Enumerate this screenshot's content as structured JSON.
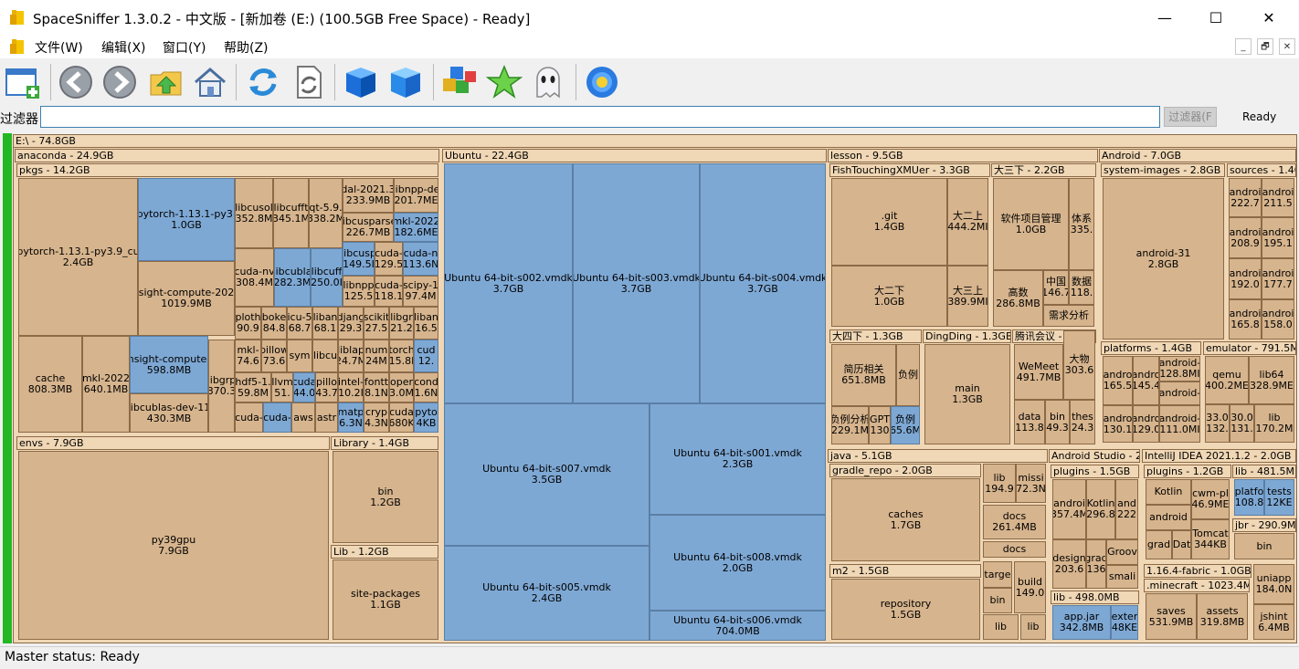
{
  "window": {
    "title": "SpaceSniffer 1.3.0.2  -  中文版  - [新加卷 (E:) (100.5GB Free Space) - Ready]",
    "minimize": "—",
    "maximize": "☐",
    "close": "✕"
  },
  "menu": {
    "items": [
      "文件(W)",
      "编辑(X)",
      "窗口(Y)",
      "帮助(Z)"
    ],
    "mdi": [
      "_",
      "🗗",
      "✕"
    ]
  },
  "toolbar": {
    "icons": [
      "new-window-icon",
      "back-icon",
      "forward-icon",
      "folder-up-icon",
      "home-icon",
      "refresh-icon",
      "reload-file-icon",
      "blue-box-icon",
      "blue-box-alt-icon",
      "colored-blocks-icon",
      "star-icon",
      "ghost-icon",
      "settings-flower-icon"
    ]
  },
  "filter": {
    "label": "过滤器",
    "value": "",
    "button": "过滤器(F",
    "status": "Ready"
  },
  "colors": {
    "file_tan": "#d6b48d",
    "folder_header": "#f0d7b5",
    "file_blue": "#7ea8d4",
    "free_space_green": "#23b823"
  },
  "tree": {
    "root": "E:\\ - 74.8GB",
    "anaconda": "anaconda - 24.9GB",
    "pkgs": "pkgs - 14.2GB",
    "f_pt_cu": "pytorch-1.13.1-py3.9_cu\n2.4GB",
    "f_pt": "pytorch-1.13.1-py3.\n1.0GB",
    "f_nsight22": "nsight-compute-2022\n1019.9MB",
    "f_libcusol": "libcusol\n352.8M",
    "f_libcufft": "libcufft\n345.1M",
    "f_qt": "qt-5.9.\n338.2M",
    "f_dal": "dal-2021.3\n233.9MB",
    "f_libnppde": "libnpp-de\n201.7ME",
    "f_libcusparse": "libcusparse\n226.7MB",
    "f_mkl22b": "mkl-2022\n182.6ME",
    "f_cudanv": "cuda-nv\n308.4M",
    "f_libcubla": "libcubla\n282.3M",
    "f_libcuff2": "libcuff\n250.0I",
    "f_libcusp": "libcusp\n149.5I",
    "f_cuda129": "cuda-\n129.5",
    "f_cudan113": "cuda-n\n113.6N",
    "f_libnpp125": "libnpp\n125.5",
    "f_cuda118": "cuda-\n118.1",
    "f_scipy": "scipy-1\n97.4M",
    "f_plot": "ploth\n90.9",
    "f_boke": "boke\n84.8",
    "f_icu": "icu-5\n68.7",
    "f_liban1": "liban\n68.1",
    "f_djan": "djang\n29.3",
    "f_scikit": "scikit\n27.5",
    "f_libgr": "libgr\n21.2",
    "f_liban2": "liban\n16.5",
    "f_mkl74": "mkl-\n74.6",
    "f_pillow": "pillow\n73.6",
    "f_sym": "sym",
    "f_libcu": "libcu",
    "f_libla": "liblap\n24.7M",
    "f_num": "num\n24M",
    "f_torch": "torch\n15.8I",
    "f_cud12": "cud\n12.",
    "f_libgrp": "libgrp\n370.3",
    "f_cache": "cache\n808.3MB",
    "f_mkl22": "mkl-2022\n640.1MB",
    "f_nsight598": "nsight-compute-\n598.8MB",
    "f_libcublasdev": "libcublas-dev-11\n430.3MB",
    "f_hdf5": "hdf5-1.\n59.8M",
    "f_llvm": "llvm\n51.",
    "f_cuda44": "cuda\n44.0",
    "f_pillo43": "pillo\n43.7",
    "f_intel": "intel-\n10.2I",
    "f_font": "fontt\n8.1N",
    "f_open": "oper\n3.0M",
    "f_cond": "cond\n1.6N",
    "f_cuda_a": "cuda-",
    "f_cuda_b": "cuda-",
    "f_aws": "aws",
    "f_astr": "astr",
    "f_matp": "matp\n6.3N",
    "f_cryp": "cryp\n4.3N",
    "f_cuda680": "cuda\n680K",
    "f_pyto": "pyto\n4KB",
    "envs": "envs - 7.9GB",
    "f_py39gpu": "py39gpu\n7.9GB",
    "library": "Library - 1.4GB",
    "f_bin": "bin\n1.2GB",
    "lib": "Lib - 1.2GB",
    "f_sitepk": "site-packages\n1.1GB",
    "ubuntu": "Ubuntu - 22.4GB",
    "f_u002": "Ubuntu 64-bit-s002.vmdk\n3.7GB",
    "f_u003": "Ubuntu 64-bit-s003.vmdk\n3.7GB",
    "f_u004": "Ubuntu 64-bit-s004.vmdk\n3.7GB",
    "f_u007": "Ubuntu 64-bit-s007.vmdk\n3.5GB",
    "f_u001": "Ubuntu 64-bit-s001.vmdk\n2.3GB",
    "f_u005": "Ubuntu 64-bit-s005.vmdk\n2.4GB",
    "f_u008": "Ubuntu 64-bit-s008.vmdk\n2.0GB",
    "f_u006": "Ubuntu 64-bit-s006.vmdk\n704.0MB",
    "lesson": "lesson - 9.5GB",
    "fish": "FishTouchingXMUer - 3.3GB",
    "f_git": ".git\n1.4GB",
    "f_d2s": "大二上\n444.2MI",
    "f_d2x": "大二下\n1.0GB",
    "f_d3s": "大三上\n389.9MI",
    "d3x": "大三下 - 2.2GB",
    "f_rj": "软件项目管理\n1.0GB",
    "f_tx": "体系\n335.",
    "f_gs": "高数\n286.8MB",
    "f_zg": "中国\n146.7",
    "f_sj": "数据\n118.",
    "f_yq": "需求分析",
    "d4x": "大四下 - 1.3GB",
    "f_jl": "简历相关\n651.8MB",
    "f_fl": "负例",
    "f_fl229": "负例分析\n229.1M",
    "f_gpt": "GPT\n130",
    "f_fl65": "负例\n65.6M",
    "dingding": "DingDing - 1.3GB",
    "f_main": "main\n1.3GB",
    "tx": "腾讯会议 -",
    "f_wemeet": "WeMeet\n491.7MB",
    "f_dw": "大物\n303.6",
    "f_data": "data\n113.8",
    "f_bin49": "bin\n49.3",
    "f_thes": "thes\n24.3",
    "java": "java - 5.1GB",
    "gradle": "gradle_repo - 2.0GB",
    "f_caches": "caches\n1.7GB",
    "f_lib194": "lib\n194.9",
    "f_miss": "missi\n72.3N",
    "f_docs261": "docs\n261.4MB",
    "f_docs": "docs",
    "m2": "m2 - 1.5GB",
    "f_repo": "repository\n1.5GB",
    "f_targ": "targe",
    "f_build": "build\n149.0",
    "f_binj": "bin",
    "f_libj1": "lib",
    "f_libj2": "lib",
    "android": "Android - 7.0GB",
    "sysimg": "system-images - 2.8GB",
    "f_a31": "android-31\n2.8GB",
    "sources": "sources - 1.40",
    "f_s1": "androi\n222.7",
    "f_s2": "androi\n211.5",
    "f_s3": "androi\n208.9",
    "f_s4": "androi\n195.1",
    "f_s5": "androi\n192.0",
    "f_s6": "androi\n177.7",
    "f_s7": "androi\n165.8",
    "f_s8": "androi\n158.0",
    "platforms": "platforms - 1.4GB",
    "f_p1": "andro\n165.5",
    "f_p2": "andro\n145.4",
    "f_p3": "android-\n128.8MI",
    "f_p4": "android-",
    "f_p5": "andro\n130.1",
    "f_p6": "andro\n129.0",
    "f_p7": "android-\n111.0MI",
    "emulator": "emulator - 791.5M",
    "f_qemu": "qemu\n400.2ME",
    "f_lib64": "lib64\n328.9ME",
    "f_e33": "33.0\n132.",
    "f_e30": "30.0\n131.",
    "f_elib": "lib\n170.2M",
    "astudio": "Android Studio - 2.",
    "asplug": "plugins - 1.5GB",
    "f_andro357": "androi\n357.4M",
    "f_kotlin296": "Kotlin\n296.8",
    "f_and222": "and\n222",
    "f_design": "design\n203.6",
    "f_grad": "grad\n136",
    "f_groov": "Groov",
    "f_smali": "smali",
    "aslib": "lib - 498.0MB",
    "f_appjar": "app.jar\n342.8MB",
    "f_exter": "exter\n48KE",
    "idea": "IntelliJ IDEA 2021.1.2 - 2.0GB",
    "ideaplug": "plugins - 1.2GB",
    "f_kotlin": "Kotlin",
    "f_android": "android",
    "f_cwm": "cwm-pl\n46.9ME",
    "f_grad2": "grad",
    "f_dat": "Dat",
    "f_tomcat": "Tomcat\n344KB",
    "idealib": "lib - 481.5M",
    "f_platfo": "platfo\n108.8",
    "f_tests": "tests\n12KE",
    "jbr": "jbr - 290.9M",
    "f_jbrbin": "bin",
    "fabric": "1.16.4-fabric - 1.0GB",
    "minecraft": ".minecraft - 1023.4MI",
    "f_saves": "saves\n531.9MB",
    "f_assets": "assets\n319.8MB",
    "f_uniapp": "uniapp\n184.0N",
    "f_jshint": "jshint\n6.4MB"
  },
  "status": {
    "text": "Master status: Ready"
  }
}
